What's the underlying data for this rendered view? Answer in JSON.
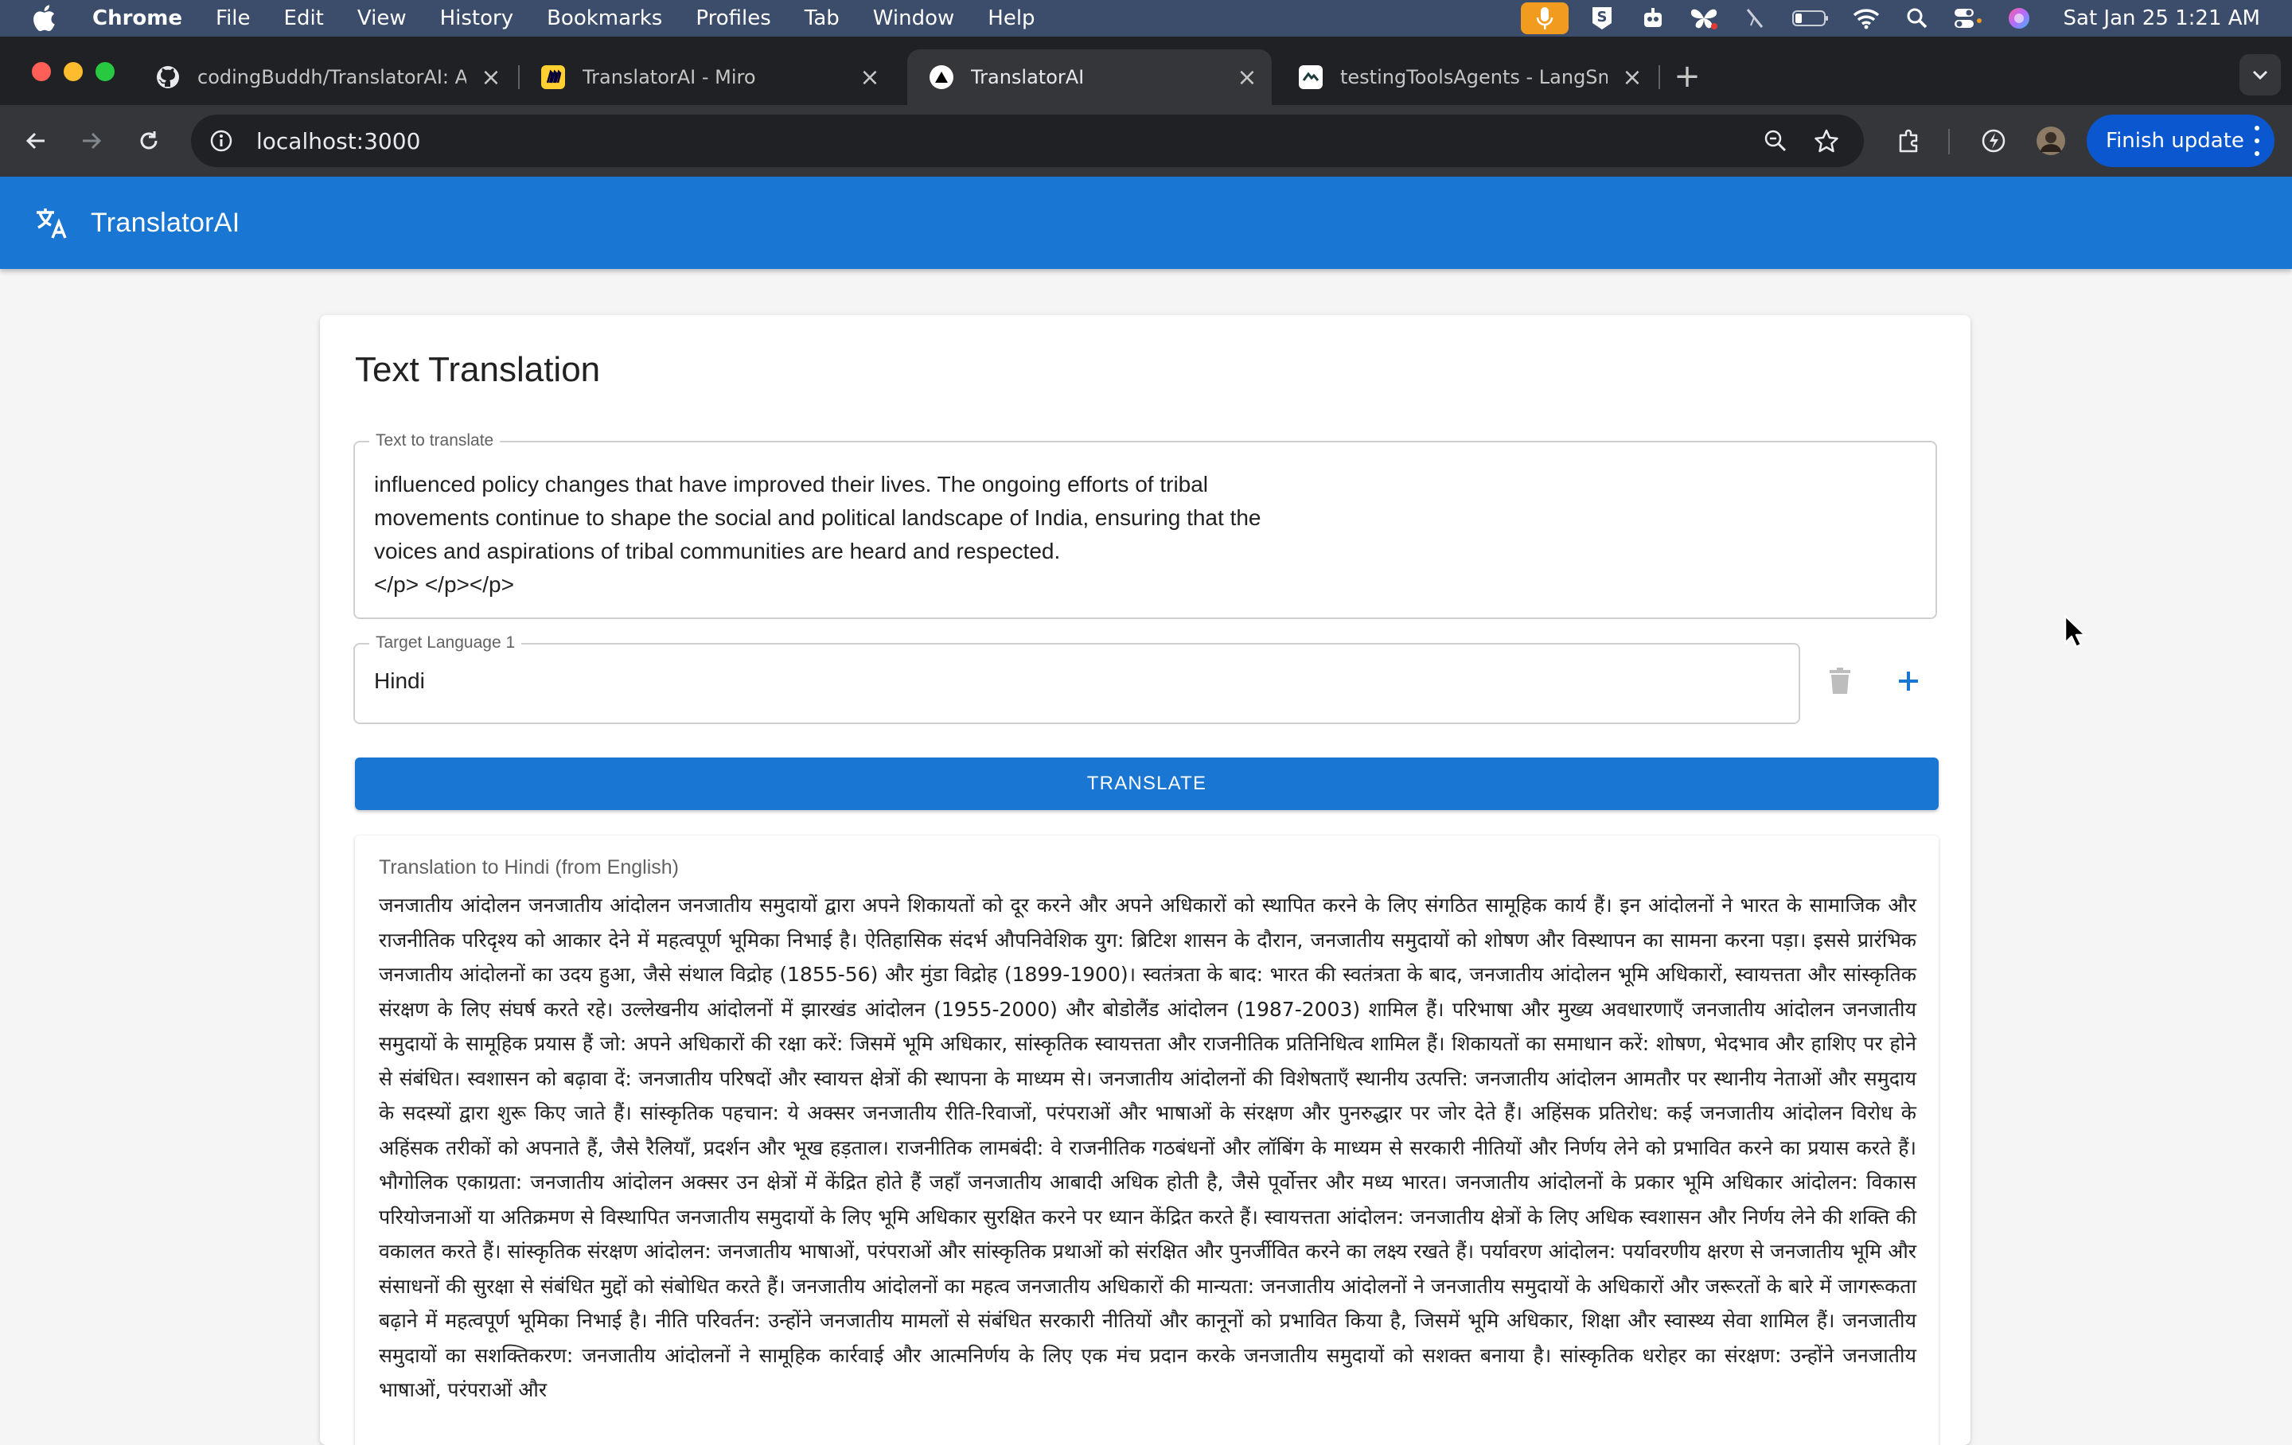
{
  "menubar": {
    "app": "Chrome",
    "items": [
      "File",
      "Edit",
      "View",
      "History",
      "Bookmarks",
      "Profiles",
      "Tab",
      "Window",
      "Help"
    ],
    "clock": "Sat Jan 25  1:21 AM"
  },
  "tabs": [
    {
      "title": "codingBuddh/TranslatorAI: A",
      "icon": "github-icon"
    },
    {
      "title": "TranslatorAI - Miro",
      "icon": "miro-icon"
    },
    {
      "title": "TranslatorAI",
      "icon": "vercel-icon",
      "active": true
    },
    {
      "title": "testingToolsAgents - LangSm",
      "icon": "langsmith-icon"
    }
  ],
  "toolbar": {
    "url": "localhost:3000",
    "finish_update": "Finish update"
  },
  "app": {
    "title": "TranslatorAI",
    "colors": {
      "primary": "#1976d2"
    }
  },
  "card": {
    "heading": "Text Translation",
    "source_label": "Text to translate",
    "source_text": "influenced policy changes that have improved their lives. The ongoing efforts of tribal\nmovements continue to shape the social and political landscape of India, ensuring that the\nvoices and aspirations of tribal communities are heard and respected.\n</p> </p></p>",
    "target_label": "Target Language 1",
    "target_value": "Hindi",
    "translate_label": "TRANSLATE",
    "result_title": "Translation to Hindi (from English)",
    "result_text": "जनजातीय आंदोलन जनजातीय आंदोलन जनजातीय समुदायों द्वारा अपने शिकायतों को दूर करने और अपने अधिकारों को स्थापित करने के लिए संगठित सामूहिक कार्य हैं। इन आंदोलनों ने भारत के सामाजिक और राजनीतिक परिदृश्य को आकार देने में महत्वपूर्ण भूमिका निभाई है। ऐतिहासिक संदर्भ औपनिवेशिक युग: ब्रिटिश शासन के दौरान, जनजातीय समुदायों को शोषण और विस्थापन का सामना करना पड़ा। इससे प्रारंभिक जनजातीय आंदोलनों का उदय हुआ, जैसे संथाल विद्रोह (1855-56) और मुंडा विद्रोह (1899-1900)। स्वतंत्रता के बाद: भारत की स्वतंत्रता के बाद, जनजातीय आंदोलन भूमि अधिकारों, स्वायत्तता और सांस्कृतिक संरक्षण के लिए संघर्ष करते रहे। उल्लेखनीय आंदोलनों में झारखंड आंदोलन (1955-2000) और बोडोलैंड आंदोलन (1987-2003) शामिल हैं। परिभाषा और मुख्य अवधारणाएँ जनजातीय आंदोलन जनजातीय समुदायों के सामूहिक प्रयास हैं जो: अपने अधिकारों की रक्षा करें: जिसमें भूमि अधिकार, सांस्कृतिक स्वायत्तता और राजनीतिक प्रतिनिधित्व शामिल हैं। शिकायतों का समाधान करें: शोषण, भेदभाव और हाशिए पर होने से संबंधित। स्वशासन को बढ़ावा दें: जनजातीय परिषदों और स्वायत्त क्षेत्रों की स्थापना के माध्यम से। जनजातीय आंदोलनों की विशेषताएँ स्थानीय उत्पत्ति: जनजातीय आंदोलन आमतौर पर स्थानीय नेताओं और समुदाय के सदस्यों द्वारा शुरू किए जाते हैं। सांस्कृतिक पहचान: ये अक्सर जनजातीय रीति-रिवाजों, परंपराओं और भाषाओं के संरक्षण और पुनरुद्धार पर जोर देते हैं। अहिंसक प्रतिरोध: कई जनजातीय आंदोलन विरोध के अहिंसक तरीकों को अपनाते हैं, जैसे रैलियाँ, प्रदर्शन और भूख हड़ताल। राजनीतिक लामबंदी: वे राजनीतिक गठबंधनों और लॉबिंग के माध्यम से सरकारी नीतियों और निर्णय लेने को प्रभावित करने का प्रयास करते हैं। भौगोलिक एकाग्रता: जनजातीय आंदोलन अक्सर उन क्षेत्रों में केंद्रित होते हैं जहाँ जनजातीय आबादी अधिक होती है, जैसे पूर्वोत्तर और मध्य भारत। जनजातीय आंदोलनों के प्रकार भूमि अधिकार आंदोलन: विकास परियोजनाओं या अतिक्रमण से विस्थापित जनजातीय समुदायों के लिए भूमि अधिकार सुरक्षित करने पर ध्यान केंद्रित करते हैं। स्वायत्तता आंदोलन: जनजातीय क्षेत्रों के लिए अधिक स्वशासन और निर्णय लेने की शक्ति की वकालत करते हैं। सांस्कृतिक संरक्षण आंदोलन: जनजातीय भाषाओं, परंपराओं और सांस्कृतिक प्रथाओं को संरक्षित और पुनर्जीवित करने का लक्ष्य रखते हैं। पर्यावरण आंदोलन: पर्यावरणीय क्षरण से जनजातीय भूमि और संसाधनों की सुरक्षा से संबंधित मुद्दों को संबोधित करते हैं। जनजातीय आंदोलनों का महत्व जनजातीय अधिकारों की मान्यता: जनजातीय आंदोलनों ने जनजातीय समुदायों के अधिकारों और जरूरतों के बारे में जागरूकता बढ़ाने में महत्वपूर्ण भूमिका निभाई है। नीति परिवर्तन: उन्होंने जनजातीय मामलों से संबंधित सरकारी नीतियों और कानूनों को प्रभावित किया है, जिसमें भूमि अधिकार, शिक्षा और स्वास्थ्य सेवा शामिल हैं। जनजातीय समुदायों का सशक्तिकरण: जनजातीय आंदोलनों ने सामूहिक कार्रवाई और आत्मनिर्णय के लिए एक मंच प्रदान करके जनजातीय समुदायों को सशक्त बनाया है। सांस्कृतिक धरोहर का संरक्षण: उन्होंने जनजातीय भाषाओं, परंपराओं और"
  }
}
